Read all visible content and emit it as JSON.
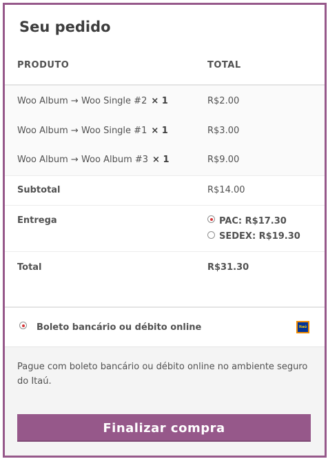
{
  "order": {
    "heading": "Seu pedido",
    "columns": {
      "product": "PRODUTO",
      "total": "TOTAL"
    },
    "items": [
      {
        "name": "Woo Album → Woo Single #2",
        "qty": "× 1",
        "total": "R$2.00"
      },
      {
        "name": "Woo Album → Woo Single #1",
        "qty": "× 1",
        "total": "R$3.00"
      },
      {
        "name": "Woo Album → Woo Album #3",
        "qty": "× 1",
        "total": "R$9.00"
      }
    ],
    "subtotal": {
      "label": "Subtotal",
      "value": "R$14.00"
    },
    "shipping": {
      "label": "Entrega",
      "options": [
        {
          "label": "PAC: R$17.30",
          "selected": true
        },
        {
          "label": "SEDEX: R$19.30",
          "selected": false
        }
      ]
    },
    "total": {
      "label": "Total",
      "value": "R$31.30"
    }
  },
  "payment": {
    "method_label": "Boleto bancário ou débito online",
    "method_logo": "itau-logo",
    "logo_text": "Itaú",
    "description": "Pague com boleto bancário ou débito online no ambiente seguro do Itaú."
  },
  "submit_label": "Finalizar compra",
  "colors": {
    "accent": "#96588a",
    "radio_dot": "#d63638"
  }
}
